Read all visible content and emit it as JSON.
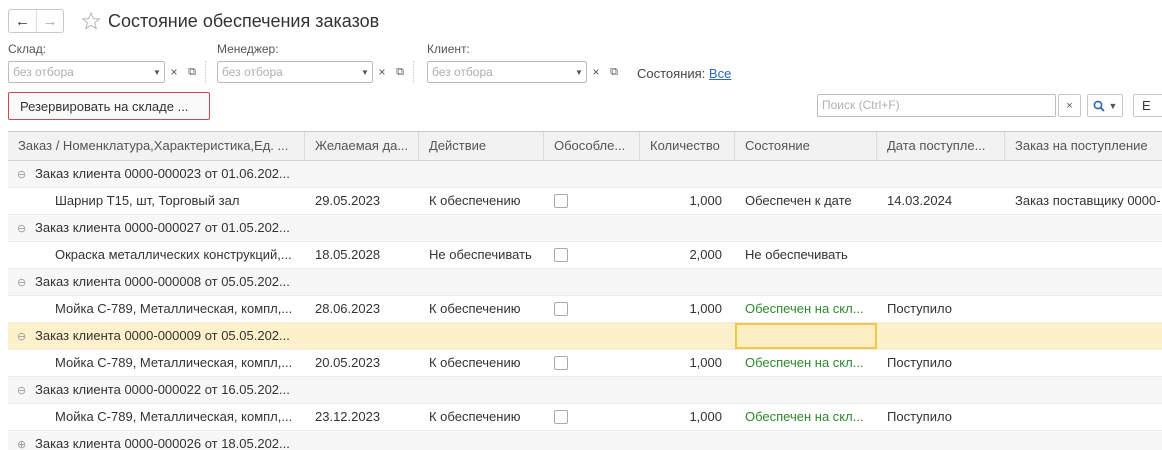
{
  "window": {
    "title": "Состояние обеспечения заказов",
    "back_icon": "←",
    "forward_icon": "→"
  },
  "filters": {
    "warehouse": {
      "label": "Склад:",
      "placeholder": "без отбора"
    },
    "manager": {
      "label": "Менеджер:",
      "placeholder": "без отбора"
    },
    "client": {
      "label": "Клиент:",
      "placeholder": "без отбора"
    },
    "clear_icon": "×",
    "dropdown_icon": "▼",
    "open_icon": "⧉",
    "states_label": "Состояния:",
    "states_value": "Все"
  },
  "toolbar": {
    "reserve_label": "Резервировать на складе ...",
    "search_placeholder": "Поиск (Ctrl+F)",
    "search_clear": "×",
    "search_dropdown": "▼",
    "more_label": "Е"
  },
  "table": {
    "columns": [
      "Заказ / Номенклатура,Характеристика,Ед. ...",
      "Желаемая да...",
      "Действие",
      "Обособле...",
      "Количество",
      "Состояние",
      "Дата поступле...",
      "Заказ на поступление"
    ],
    "rows": [
      {
        "type": "group",
        "toggle": "⊖",
        "order": "Заказ клиента 0000-000023 от 01.06.202..."
      },
      {
        "type": "item",
        "name": "Шарнир Т15, шт, Торговый зал",
        "date": "29.05.2023",
        "action": "К обеспечению",
        "qty": "1,000",
        "state": "Обеспечен к дате",
        "state_color": "normal",
        "arrival": "14.03.2024",
        "supply_order": "Заказ поставщику 0000-"
      },
      {
        "type": "group",
        "toggle": "⊖",
        "order": "Заказ клиента 0000-000027 от 01.05.202..."
      },
      {
        "type": "item",
        "name": "Окраска металлических конструкций,...",
        "date": "18.05.2028",
        "action": "Не обеспечивать",
        "qty": "2,000",
        "state": "Не обеспечивать",
        "state_color": "normal",
        "arrival": "",
        "supply_order": ""
      },
      {
        "type": "group",
        "toggle": "⊖",
        "order": "Заказ клиента 0000-000008 от 05.05.202..."
      },
      {
        "type": "item",
        "name": "Мойка С-789, Металлическая, компл,...",
        "date": "28.06.2023",
        "action": "К обеспечению",
        "qty": "1,000",
        "state": "Обеспечен на скл...",
        "state_color": "green",
        "arrival": "Поступило",
        "supply_order": ""
      },
      {
        "type": "group",
        "toggle": "⊖",
        "order": "Заказ клиента 0000-000009 от 05.05.202...",
        "selected": true
      },
      {
        "type": "item",
        "name": "Мойка С-789, Металлическая, компл,...",
        "date": "20.05.2023",
        "action": "К обеспечению",
        "qty": "1,000",
        "state": "Обеспечен на скл...",
        "state_color": "green",
        "arrival": "Поступило",
        "supply_order": ""
      },
      {
        "type": "group",
        "toggle": "⊖",
        "order": "Заказ клиента 0000-000022 от 16.05.202..."
      },
      {
        "type": "item",
        "name": "Мойка С-789, Металлическая, компл,...",
        "date": "23.12.2023",
        "action": "К обеспечению",
        "qty": "1,000",
        "state": "Обеспечен на скл...",
        "state_color": "green",
        "arrival": "Поступило",
        "supply_order": ""
      },
      {
        "type": "group",
        "toggle": "⊕",
        "order": "Заказ клиента 0000-000026 от 18.05.202..."
      }
    ]
  },
  "colors": {
    "accent_red": "#d9434c",
    "selection": "#fdf1cc",
    "focus": "#f2c744",
    "green": "#2d8a2d",
    "link": "#2c67b8"
  }
}
